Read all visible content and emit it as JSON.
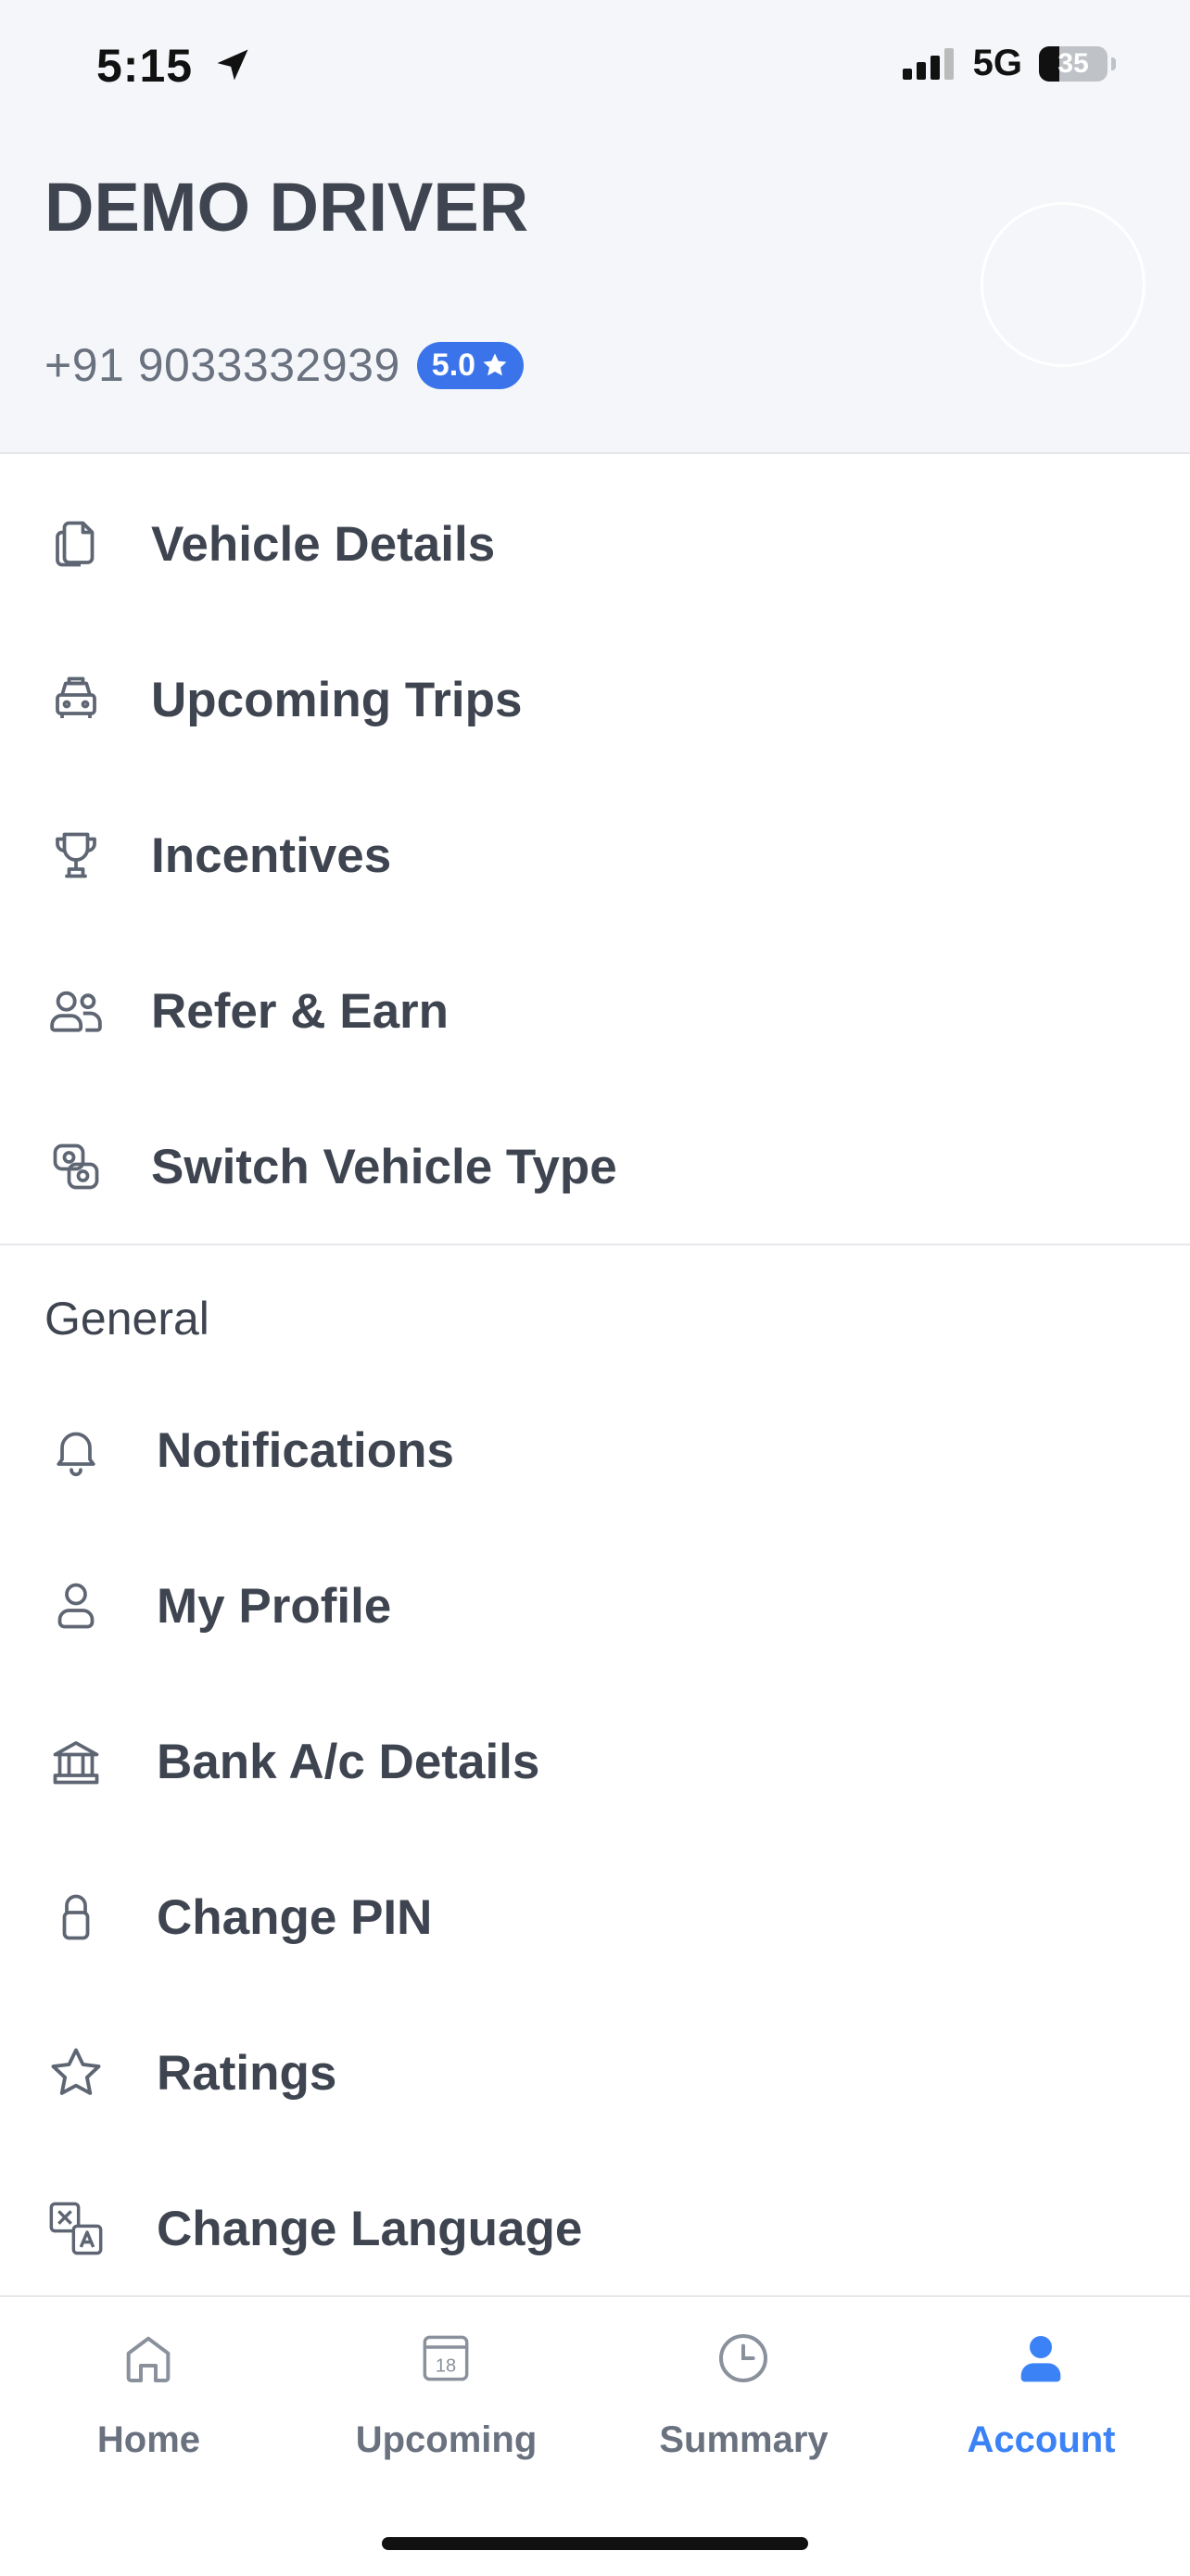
{
  "status_bar": {
    "time": "5:15",
    "network": "5G",
    "battery": "35"
  },
  "profile": {
    "name": "DEMO DRIVER",
    "phone": "+91 9033332939",
    "rating": "5.0"
  },
  "menu_primary": [
    {
      "label": "Vehicle Details",
      "icon": "document-icon"
    },
    {
      "label": "Upcoming Trips",
      "icon": "car-icon"
    },
    {
      "label": "Incentives",
      "icon": "trophy-icon"
    },
    {
      "label": "Refer & Earn",
      "icon": "users-icon"
    },
    {
      "label": "Switch Vehicle Type",
      "icon": "switch-icon"
    }
  ],
  "general": {
    "title": "General",
    "items": [
      {
        "label": "Notifications",
        "icon": "bell-icon"
      },
      {
        "label": "My Profile",
        "icon": "user-icon"
      },
      {
        "label": "Bank A/c Details",
        "icon": "bank-icon"
      },
      {
        "label": "Change PIN",
        "icon": "lock-icon"
      },
      {
        "label": "Ratings",
        "icon": "star-icon"
      },
      {
        "label": "Change Language",
        "icon": "translate-icon"
      }
    ]
  },
  "bottom_nav": [
    {
      "label": "Home",
      "icon": "home-icon"
    },
    {
      "label": "Upcoming",
      "icon": "calendar-icon",
      "calendar_day": "18"
    },
    {
      "label": "Summary",
      "icon": "clock-icon"
    },
    {
      "label": "Account",
      "icon": "account-icon",
      "active": true
    }
  ],
  "colors": {
    "accent": "#3b82f6",
    "badge": "#3b74ea",
    "text": "#3f4550",
    "muted": "#6a7280",
    "header_bg": "#f4f6f9"
  }
}
